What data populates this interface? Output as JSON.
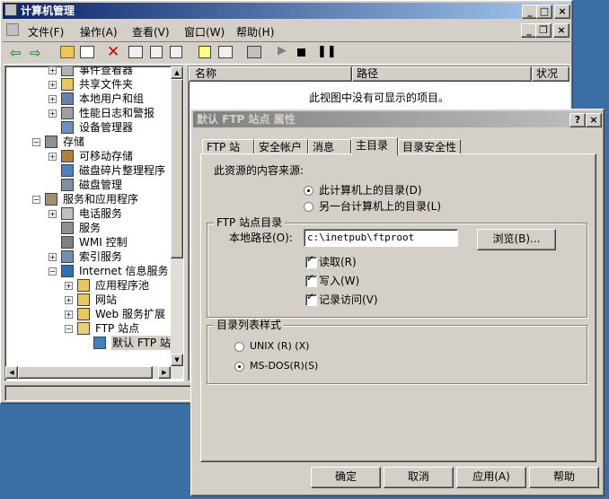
{
  "main_window": {
    "title": "计算机管理",
    "controls": {
      "minimize": "_",
      "maximize": "□",
      "close": "×"
    },
    "menu": [
      "文件(F)",
      "操作(A)",
      "查看(V)",
      "窗口(W)",
      "帮助(H)"
    ],
    "inner_controls": {
      "minimize": "_",
      "restore": "❐",
      "close": "×"
    }
  },
  "tree": [
    {
      "label": "事件查看器",
      "icon": "event-viewer-icon",
      "expander": "+"
    },
    {
      "label": "共享文件夹",
      "icon": "shared-folder-icon",
      "expander": "+"
    },
    {
      "label": "本地用户和组",
      "icon": "users-icon",
      "expander": "+"
    },
    {
      "label": "性能日志和警报",
      "icon": "performance-icon",
      "expander": "+"
    },
    {
      "label": "设备管理器",
      "icon": "device-manager-icon",
      "expander": ""
    },
    {
      "label": "存储",
      "icon": "storage-icon",
      "expander": "−"
    },
    {
      "label": "可移动存储",
      "icon": "removable-storage-icon",
      "expander": "+"
    },
    {
      "label": "磁盘碎片整理程序",
      "icon": "defrag-icon",
      "expander": ""
    },
    {
      "label": "磁盘管理",
      "icon": "disk-management-icon",
      "expander": ""
    },
    {
      "label": "服务和应用程序",
      "icon": "services-apps-icon",
      "expander": "−"
    },
    {
      "label": "电话服务",
      "icon": "telephony-icon",
      "expander": "+"
    },
    {
      "label": "服务",
      "icon": "services-icon",
      "expander": ""
    },
    {
      "label": "WMI 控制",
      "icon": "wmi-icon",
      "expander": ""
    },
    {
      "label": "索引服务",
      "icon": "indexing-icon",
      "expander": "+"
    },
    {
      "label": "Internet 信息服务（II",
      "icon": "iis-icon",
      "expander": "−"
    },
    {
      "label": "应用程序池",
      "icon": "folder-icon",
      "expander": "+"
    },
    {
      "label": "网站",
      "icon": "folder-icon",
      "expander": "+"
    },
    {
      "label": "Web 服务扩展",
      "icon": "folder-icon",
      "expander": "+"
    },
    {
      "label": "FTP 站点",
      "icon": "folder-open-icon",
      "expander": "−"
    },
    {
      "label": "默认 FTP 站点",
      "icon": "ftp-site-icon",
      "expander": ""
    }
  ],
  "list": {
    "columns": [
      "名称",
      "路径",
      "状况"
    ],
    "empty_message": "此视图中没有可显示的项目。"
  },
  "dialog": {
    "title": "默认 FTP 站点 属性",
    "help": "?",
    "close": "×",
    "tabs": [
      "FTP 站点",
      "安全帐户",
      "消息",
      "主目录",
      "目录安全性"
    ],
    "active_tab": "主目录",
    "source_label": "此资源的内容来源:",
    "source_options": [
      "此计算机上的目录(D)",
      "另一台计算机上的目录(L)"
    ],
    "ftp_dir_group": "FTP 站点目录",
    "local_path_label": "本地路径(O):",
    "local_path_value": "c:\\inetpub\\ftproot",
    "browse": "浏览(B)...",
    "checkboxes": [
      {
        "label": "读取(R)",
        "checked": true
      },
      {
        "label": "写入(W)",
        "checked": true
      },
      {
        "label": "记录访问(V)",
        "checked": true
      }
    ],
    "listing_group": "目录列表样式",
    "listing_options": [
      "UNIX (R) (X)",
      "MS-DOS(R)(S)"
    ],
    "selected_listing": "MS-DOS(R)(S)",
    "buttons": {
      "ok": "确定",
      "cancel": "取消",
      "apply": "应用(A)",
      "help": "帮助"
    }
  },
  "colors": {
    "title_active": "#0a246a",
    "title_active_end": "#a6caf0",
    "title_inactive": "#808080",
    "desktop": "#3a6ea5",
    "face": "#d4d0c8"
  }
}
